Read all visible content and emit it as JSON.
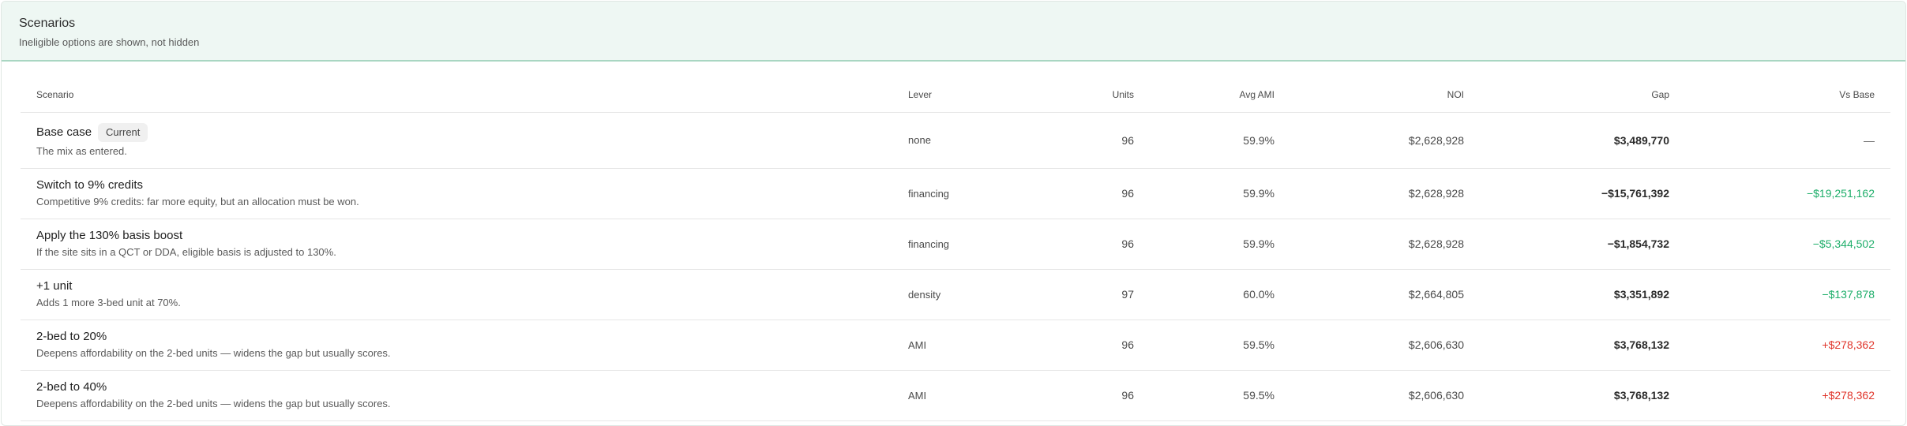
{
  "header": {
    "title": "Scenarios",
    "subtitle": "Ineligible options are shown, not hidden"
  },
  "columns": {
    "scenario": "Scenario",
    "lever": "Lever",
    "units": "Units",
    "avg_ami": "Avg AMI",
    "noi": "NOI",
    "gap": "Gap",
    "vs_base": "Vs Base"
  },
  "colors": {
    "positive": "#1eae6a",
    "negative": "#e0352b",
    "neutral": "#6a6a6a"
  },
  "rows": [
    {
      "title": "Base case",
      "badge": "Current",
      "description": "The mix as entered.",
      "lever": "none",
      "units": "96",
      "avg_ami": "59.9%",
      "noi": "$2,628,928",
      "gap": "$3,489,770",
      "vs_base": "—",
      "vs_tone": "neutral"
    },
    {
      "title": "Switch to 9% credits",
      "badge": "",
      "description": "Competitive 9% credits: far more equity, but an allocation must be won.",
      "lever": "financing",
      "units": "96",
      "avg_ami": "59.9%",
      "noi": "$2,628,928",
      "gap": "−$15,761,392",
      "vs_base": "−$19,251,162",
      "vs_tone": "positive"
    },
    {
      "title": "Apply the 130% basis boost",
      "badge": "",
      "description": "If the site sits in a QCT or DDA, eligible basis is adjusted to 130%.",
      "lever": "financing",
      "units": "96",
      "avg_ami": "59.9%",
      "noi": "$2,628,928",
      "gap": "−$1,854,732",
      "vs_base": "−$5,344,502",
      "vs_tone": "positive"
    },
    {
      "title": "+1 unit",
      "badge": "",
      "description": "Adds 1 more 3-bed unit at 70%.",
      "lever": "density",
      "units": "97",
      "avg_ami": "60.0%",
      "noi": "$2,664,805",
      "gap": "$3,351,892",
      "vs_base": "−$137,878",
      "vs_tone": "positive"
    },
    {
      "title": "2-bed to 20%",
      "badge": "",
      "description": "Deepens affordability on the 2-bed units — widens the gap but usually scores.",
      "lever": "AMI",
      "units": "96",
      "avg_ami": "59.5%",
      "noi": "$2,606,630",
      "gap": "$3,768,132",
      "vs_base": "+$278,362",
      "vs_tone": "negative"
    },
    {
      "title": "2-bed to 40%",
      "badge": "",
      "description": "Deepens affordability on the 2-bed units — widens the gap but usually scores.",
      "lever": "AMI",
      "units": "96",
      "avg_ami": "59.5%",
      "noi": "$2,606,630",
      "gap": "$3,768,132",
      "vs_base": "+$278,362",
      "vs_tone": "negative"
    }
  ]
}
